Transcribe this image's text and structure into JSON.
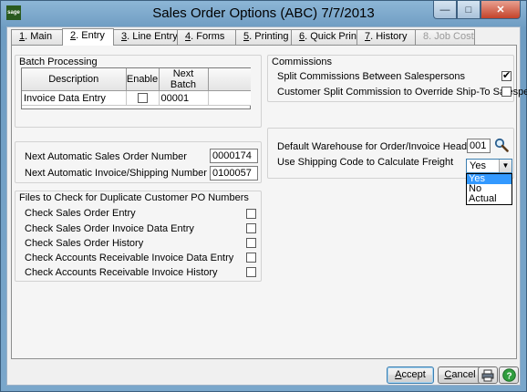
{
  "window": {
    "title": "Sales Order Options (ABC) 7/7/2013",
    "app_icon_text": "sage",
    "minimize": "—",
    "maximize": "□",
    "close": "✕"
  },
  "tabs": [
    {
      "key": "1",
      "rest": ". Main"
    },
    {
      "key": "2",
      "rest": ". Entry"
    },
    {
      "key": "3",
      "rest": ". Line Entry"
    },
    {
      "key": "4",
      "rest": ". Forms"
    },
    {
      "key": "5",
      "rest": ". Printing"
    },
    {
      "key": "6",
      "rest": ". Quick Print"
    },
    {
      "key": "7",
      "rest": ". History"
    },
    {
      "key": "8",
      "rest": ". Job Cost"
    }
  ],
  "batch": {
    "title": "Batch Processing",
    "columns": [
      "Description",
      "Enable",
      "Next Batch"
    ],
    "row": {
      "description": "Invoice Data Entry",
      "enabled": false,
      "next_batch": "00001"
    }
  },
  "commissions": {
    "title": "Commissions",
    "items": [
      {
        "label": "Split Commissions Between Salespersons",
        "checked": true
      },
      {
        "label": "Customer Split Commission to Override Ship-To Salesperson",
        "checked": false
      }
    ]
  },
  "numbers": {
    "sales_order_label": "Next Automatic Sales Order Number",
    "sales_order_value": "0000174",
    "invoice_label": "Next Automatic Invoice/Shipping Number",
    "invoice_value": "0100057"
  },
  "warehouse": {
    "label": "Default Warehouse for Order/Invoice Header",
    "value": "001",
    "shipping_label": "Use Shipping Code to Calculate Freight",
    "shipping_value": "Yes",
    "options": [
      "Yes",
      "No",
      "Actual"
    ]
  },
  "duplicates": {
    "title": "Files to Check for Duplicate Customer PO Numbers",
    "items": [
      {
        "label": "Check Sales Order Entry",
        "checked": false
      },
      {
        "label": "Check Sales Order Invoice Data Entry",
        "checked": false
      },
      {
        "label": "Check Sales Order History",
        "checked": false
      },
      {
        "label": "Check Accounts Receivable Invoice Data Entry",
        "checked": false
      },
      {
        "label": "Check Accounts Receivable Invoice History",
        "checked": false
      }
    ]
  },
  "buttons": {
    "accept_key": "A",
    "accept_rest": "ccept",
    "cancel_key": "C",
    "cancel_rest": "ancel",
    "print_icon": "printer-icon",
    "help_icon": "help-icon"
  }
}
